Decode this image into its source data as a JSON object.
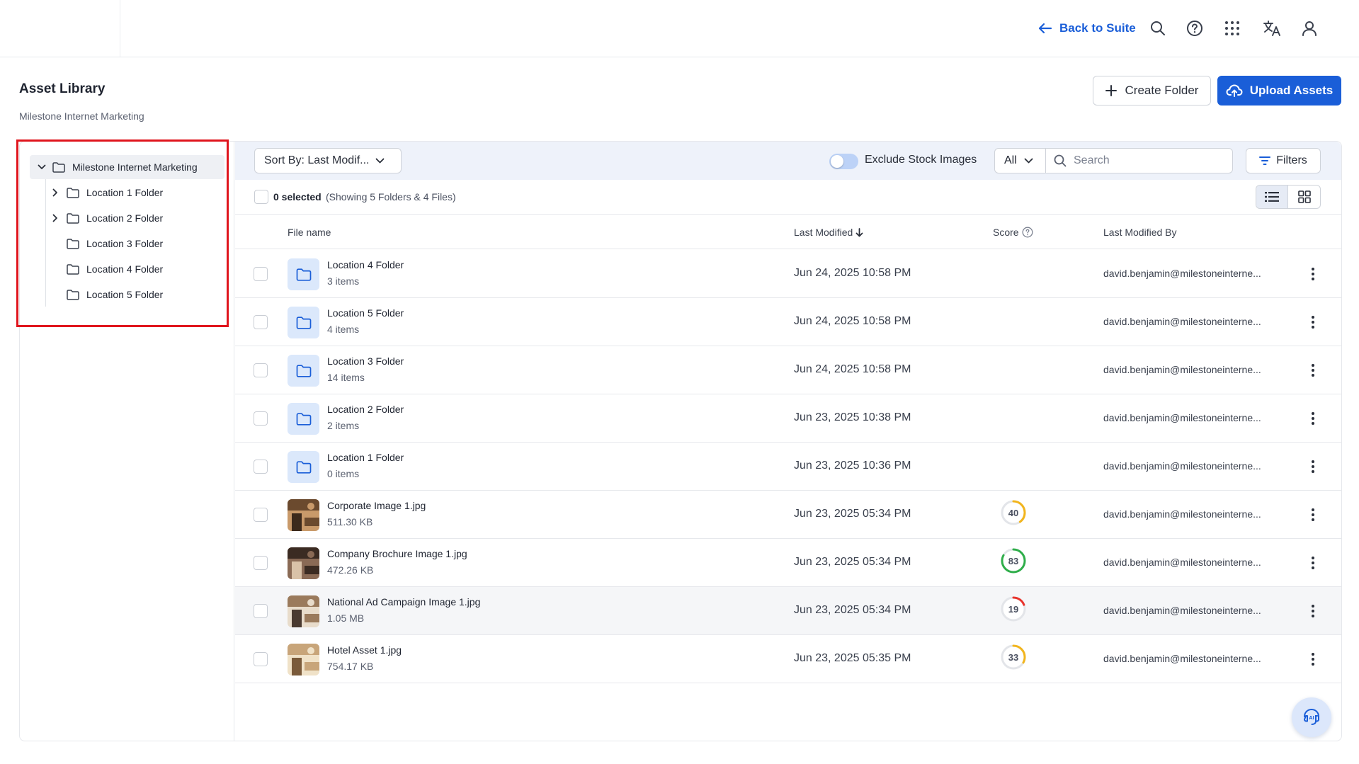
{
  "header": {
    "back_label": "Back to Suite",
    "icons": [
      "search-icon",
      "help-icon",
      "apps-grid-icon",
      "translate-icon",
      "user-icon"
    ]
  },
  "page": {
    "title": "Asset Library",
    "subtitle": "Milestone Internet Marketing",
    "create_folder_label": "Create Folder",
    "upload_label": "Upload Assets"
  },
  "tree": {
    "root": "Milestone Internet Marketing",
    "items": [
      {
        "label": "Location 1 Folder",
        "expandable": true
      },
      {
        "label": "Location 2 Folder",
        "expandable": true
      },
      {
        "label": "Location 3 Folder",
        "expandable": false
      },
      {
        "label": "Location 4 Folder",
        "expandable": false
      },
      {
        "label": "Location 5 Folder",
        "expandable": false
      }
    ]
  },
  "toolbar": {
    "sort_label": "Sort By: Last Modif...",
    "exclude_stock_label": "Exclude Stock Images",
    "exclude_stock_on": false,
    "type_filter": "All",
    "search_placeholder": "Search",
    "filters_label": "Filters"
  },
  "selection": {
    "count_label": "0 selected",
    "info": "(Showing 5 Folders & 4 Files)"
  },
  "table": {
    "columns": {
      "file_name": "File name",
      "last_modified": "Last Modified",
      "score": "Score",
      "last_modified_by": "Last Modified By"
    },
    "rows": [
      {
        "type": "folder",
        "name": "Location 4 Folder",
        "sub": "3 items",
        "date": "Jun 24, 2025 10:58 PM",
        "score": null,
        "by": "david.benjamin@milestoneinterne..."
      },
      {
        "type": "folder",
        "name": "Location 5 Folder",
        "sub": "4 items",
        "date": "Jun 24, 2025 10:58 PM",
        "score": null,
        "by": "david.benjamin@milestoneinterne..."
      },
      {
        "type": "folder",
        "name": "Location 3 Folder",
        "sub": "14 items",
        "date": "Jun 24, 2025 10:58 PM",
        "score": null,
        "by": "david.benjamin@milestoneinterne..."
      },
      {
        "type": "folder",
        "name": "Location 2 Folder",
        "sub": "2 items",
        "date": "Jun 23, 2025 10:38 PM",
        "score": null,
        "by": "david.benjamin@milestoneinterne..."
      },
      {
        "type": "folder",
        "name": "Location 1 Folder",
        "sub": "0 items",
        "date": "Jun 23, 2025 10:36 PM",
        "score": null,
        "by": "david.benjamin@milestoneinterne..."
      },
      {
        "type": "image",
        "name": "Corporate Image 1.jpg",
        "sub": "511.30 KB",
        "date": "Jun 23, 2025 05:34 PM",
        "score": "40",
        "score_color": "#f2b51d",
        "by": "david.benjamin@milestoneinterne...",
        "thumb": [
          "#6b4a2e",
          "#c99a6a",
          "#3c2a1c"
        ]
      },
      {
        "type": "image",
        "name": "Company Brochure Image 1.jpg",
        "sub": "472.26 KB",
        "date": "Jun 23, 2025 05:34 PM",
        "score": "83",
        "score_color": "#2fae4a",
        "by": "david.benjamin@milestoneinterne...",
        "thumb": [
          "#3b2b22",
          "#8a6a55",
          "#d9c2a8"
        ]
      },
      {
        "type": "image",
        "name": "National Ad Campaign Image 1.jpg",
        "sub": "1.05 MB",
        "date": "Jun 23, 2025 05:34 PM",
        "score": "19",
        "score_color": "#e8332c",
        "by": "david.benjamin@milestoneinterne...",
        "thumb": [
          "#9a7a5c",
          "#e8dccb",
          "#4a3a30"
        ]
      },
      {
        "type": "image",
        "name": "Hotel Asset 1.jpg",
        "sub": "754.17 KB",
        "date": "Jun 23, 2025 05:35 PM",
        "score": "33",
        "score_color": "#f2b51d",
        "by": "david.benjamin@milestoneinterne...",
        "thumb": [
          "#c8a57a",
          "#f0e2c8",
          "#7a5a3a"
        ]
      }
    ]
  },
  "colors": {
    "accent": "#1a5ed8",
    "highlight_border": "#e0151d",
    "toolbar_bg": "#eef2fa"
  }
}
